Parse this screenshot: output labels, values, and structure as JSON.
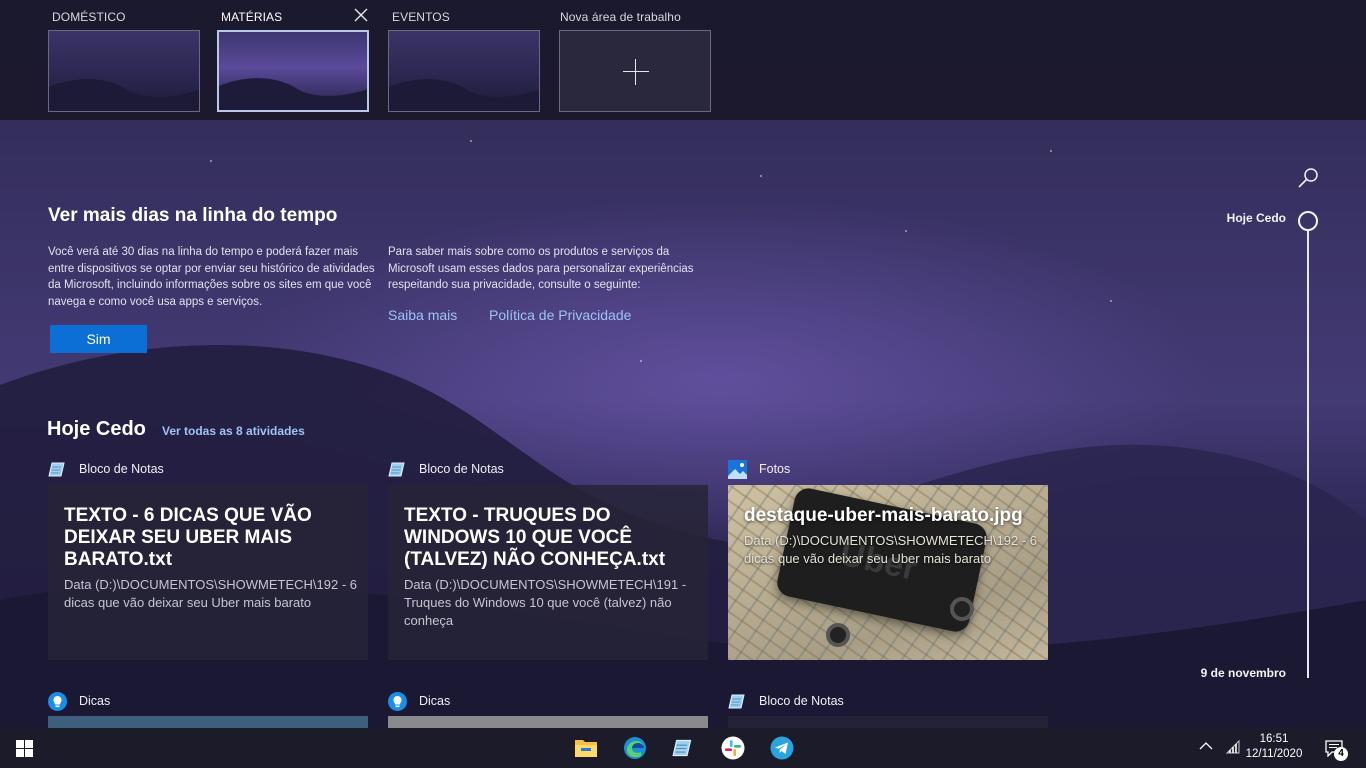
{
  "virtual_desktops": [
    {
      "label": "DOMÉSTICO",
      "active": false
    },
    {
      "label": "MATÉRIAS",
      "active": true
    },
    {
      "label": "EVENTOS",
      "active": false
    }
  ],
  "new_desktop_label": "Nova área de trabalho",
  "promo": {
    "title": "Ver mais dias na linha do tempo",
    "left_text": "Você verá até 30 dias na linha do tempo e poderá fazer mais entre dispositivos se optar por enviar seu histórico de atividades da Microsoft, incluindo informações sobre os sites em que você navega e como você usa apps e serviços.",
    "right_text": "Para saber mais sobre como os produtos e serviços da Microsoft usam esses dados para personalizar experiências respeitando sua privacidade, consulte o seguinte:",
    "yes_button": "Sim",
    "link_learn_more": "Saiba mais",
    "link_privacy": "Política de Privacidade"
  },
  "section": {
    "title": "Hoje Cedo",
    "see_all": "Ver todas as 8 atividades"
  },
  "activities": [
    {
      "app": "Bloco de Notas",
      "icon": "notepad-icon",
      "title": "TEXTO - 6 DICAS QUE VÃO DEIXAR SEU UBER MAIS BARATO.txt",
      "subtitle": "Data (D:)\\DOCUMENTOS\\SHOWMETECH\\192 - 6 dicas que vão deixar seu Uber mais barato"
    },
    {
      "app": "Bloco de Notas",
      "icon": "notepad-icon",
      "title": "TEXTO - TRUQUES DO WINDOWS 10 QUE VOCÊ (TALVEZ) NÃO CONHEÇA.txt",
      "subtitle": "Data (D:)\\DOCUMENTOS\\SHOWMETECH\\191 - Truques do Windows 10 que você (talvez) não conheça"
    },
    {
      "app": "Fotos",
      "icon": "photos-icon",
      "title": "destaque-uber-mais-barato.jpg",
      "subtitle": "Data (D:)\\DOCUMENTOS\\SHOWMETECH\\192 - 6 dicas que vão deixar seu Uber mais barato",
      "photo_brand": "Uber"
    }
  ],
  "next_row": [
    {
      "app": "Dicas",
      "icon": "tips-icon"
    },
    {
      "app": "Dicas",
      "icon": "tips-icon"
    },
    {
      "app": "Bloco de Notas",
      "icon": "notepad-icon"
    }
  ],
  "timeline": {
    "top_label": "Hoje Cedo",
    "bottom_label": "9 de novembro"
  },
  "taskbar": {
    "apps": [
      "file-explorer-icon",
      "edge-icon",
      "notepad-icon",
      "slack-icon",
      "telegram-icon"
    ],
    "time": "16:51",
    "date": "12/11/2020",
    "notification_count": "4"
  }
}
